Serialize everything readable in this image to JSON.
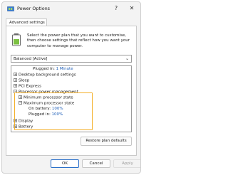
{
  "window": {
    "title": "Power Options",
    "help_glyph": "?",
    "close_glyph": "✕",
    "icon": "power-options-icon"
  },
  "tab": {
    "label": "Advanced settings"
  },
  "info": {
    "icon": "battery-info-icon",
    "text": "Select the power plan that you want to customise, then choose settings that reflect how you want your computer to manage power."
  },
  "plan": {
    "selected": "Balanced [Active]"
  },
  "settings": {
    "partial_row": {
      "label": "Plugged in:",
      "value": "1 Minute"
    },
    "items": [
      {
        "label": "Desktop background settings",
        "expander": "+"
      },
      {
        "label": "Sleep",
        "expander": "+"
      },
      {
        "label": "PCI Express",
        "expander": "+"
      },
      {
        "label": "Processor power management",
        "expander": "−"
      },
      {
        "label": "Minimum processor state",
        "expander": "+"
      },
      {
        "label": "Maximum processor state",
        "expander": "−"
      },
      {
        "label": "On battery:",
        "value": "100%"
      },
      {
        "label": "Plugged in:",
        "value": "100%"
      },
      {
        "label": "Display",
        "expander": "+"
      },
      {
        "label": "Battery",
        "expander": "+"
      }
    ]
  },
  "restore_label": "Restore plan defaults",
  "buttons": {
    "ok": "OK",
    "cancel": "Cancel",
    "apply": "Apply"
  },
  "colors": {
    "highlight": "#f3b02a",
    "link": "#1e5eb8",
    "ok_border": "#2a6fc9"
  }
}
